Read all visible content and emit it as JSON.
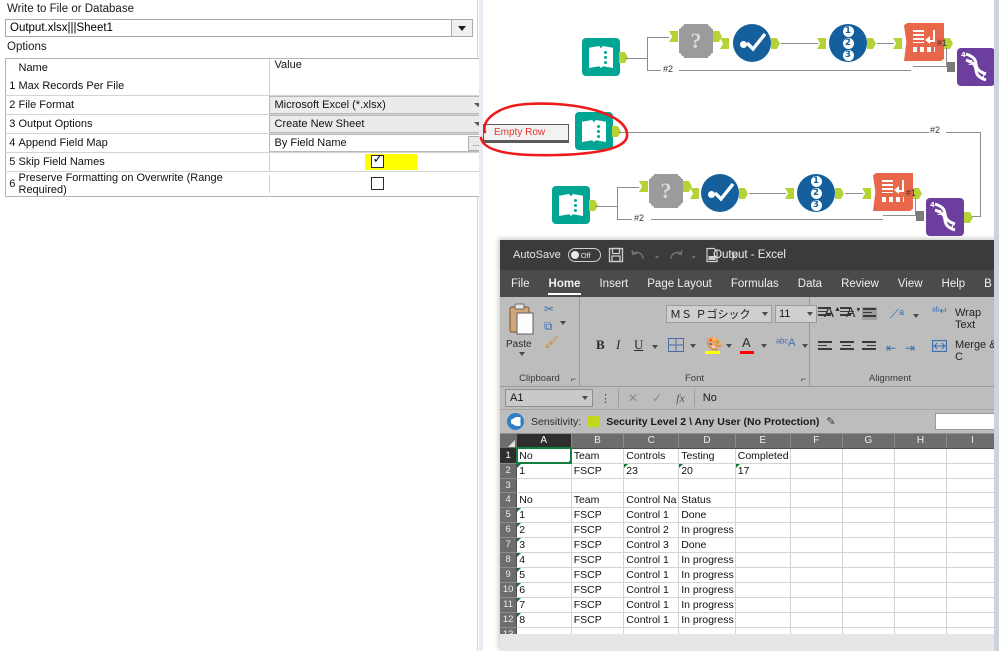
{
  "config_panel": {
    "title": "Write to File or Database",
    "file_value": "Output.xlsx|||Sheet1",
    "options_label": "Options",
    "columns": {
      "name": "Name",
      "value": "Value"
    },
    "rows": [
      {
        "num": "1",
        "name": "Max Records Per File",
        "value": "",
        "control": "blank"
      },
      {
        "num": "2",
        "name": "File Format",
        "value": "Microsoft Excel (*.xlsx)",
        "control": "combo"
      },
      {
        "num": "3",
        "name": "Output Options",
        "value": "Create New Sheet",
        "control": "combo"
      },
      {
        "num": "4",
        "name": "Append Field Map",
        "value": "By Field Name",
        "control": "text-ellipsis",
        "ellipsis": "..."
      },
      {
        "num": "5",
        "name": "Skip Field Names",
        "value": "",
        "control": "checkbox-checked-highlighted"
      },
      {
        "num": "6",
        "name": "Preserve Formatting on Overwrite (Range Required)",
        "value": "",
        "control": "checkbox-unchecked"
      }
    ]
  },
  "canvas": {
    "annotation": {
      "comment_label": "Empty Row",
      "highlight_color": "#ff0000"
    },
    "connection_labels": {
      "out2_top": "#2",
      "out2_bottom": "#2",
      "out1_top": "#1",
      "out1_bottom": "#1",
      "row_mid": "#2"
    },
    "tools": [
      {
        "id": "browse-top",
        "icon": "browse-icon",
        "color": "#00a693"
      },
      {
        "id": "dynamic-input-top",
        "icon": "gear-question-icon",
        "color": "#9b9b9b"
      },
      {
        "id": "filter-top",
        "icon": "filter-check-icon",
        "color": "#15609c"
      },
      {
        "id": "sort-top",
        "icon": "sort-123-icon",
        "color": "#15609c"
      },
      {
        "id": "output-data-top",
        "icon": "output-data-icon",
        "color": "#e8664a"
      },
      {
        "id": "macro-top",
        "icon": "batch-macro-icon",
        "color": "#6c3f9e"
      },
      {
        "id": "browse-mid",
        "icon": "browse-icon",
        "color": "#00a693"
      },
      {
        "id": "browse-bottom",
        "icon": "browse-icon",
        "color": "#00a693"
      },
      {
        "id": "dynamic-input-bottom",
        "icon": "gear-question-icon",
        "color": "#9b9b9b"
      },
      {
        "id": "filter-bottom",
        "icon": "filter-check-icon",
        "color": "#15609c"
      },
      {
        "id": "sort-bottom",
        "icon": "sort-123-icon",
        "color": "#15609c"
      },
      {
        "id": "output-data-bottom",
        "icon": "output-data-icon",
        "color": "#e8664a"
      },
      {
        "id": "macro-bottom",
        "icon": "batch-macro-icon",
        "color": "#6c3f9e"
      }
    ]
  },
  "excel": {
    "titlebar": {
      "autosave_label": "AutoSave",
      "autosave_state": "Off",
      "document_title": "Output  -  Excel",
      "quick_access": [
        "save-icon",
        "undo-icon",
        "redo-icon",
        "print-preview-icon",
        "customize-qat-icon"
      ]
    },
    "tabs": [
      {
        "label": "File",
        "active": false
      },
      {
        "label": "Home",
        "active": true
      },
      {
        "label": "Insert",
        "active": false
      },
      {
        "label": "Page Layout",
        "active": false
      },
      {
        "label": "Formulas",
        "active": false
      },
      {
        "label": "Data",
        "active": false
      },
      {
        "label": "Review",
        "active": false
      },
      {
        "label": "View",
        "active": false
      },
      {
        "label": "Help",
        "active": false
      },
      {
        "label": "B",
        "active": false
      }
    ],
    "ribbon": {
      "groups": [
        {
          "name": "Clipboard",
          "label": "Clipboard"
        },
        {
          "name": "Font",
          "label": "Font"
        },
        {
          "name": "Alignment",
          "label": "Alignment"
        }
      ],
      "clipboard": {
        "paste_label": "Paste"
      },
      "font": {
        "font_name": "ＭＳ Ｐゴシック",
        "font_size": "11",
        "bold": "B",
        "italic": "I",
        "underline": "U",
        "grow_font": "A",
        "shrink_font": "A",
        "fill_color": "#ffff00",
        "font_color": "#ff0000"
      },
      "alignment": {
        "wrap_text": "Wrap Text",
        "merge_center": "Merge & C"
      }
    },
    "formula_bar": {
      "name_box": "A1",
      "cancel_icon": "close-icon",
      "enter_icon": "check-icon",
      "function_icon": "fx-icon",
      "formula_value": "No"
    },
    "sensitivity_bar": {
      "icon": "sensitivity-label-icon",
      "label": "Sensitivity:",
      "swatch_color": "#c2d71a",
      "value": "Security Level 2 \\ Any User (No Protection)",
      "edit_icon": "pencil-icon"
    },
    "grid": {
      "column_headers": [
        "A",
        "B",
        "C",
        "D",
        "E",
        "F",
        "G",
        "H",
        "I"
      ],
      "selected_column": "A",
      "selected_row": "1",
      "active_cell": "A1",
      "row_numbers": [
        "1",
        "2",
        "3",
        "4",
        "5",
        "6",
        "7",
        "8",
        "9",
        "10",
        "11",
        "12",
        "13"
      ],
      "rows": [
        {
          "n": "1",
          "cells": [
            "No",
            "Team",
            "Controls",
            "Testing",
            "Completed",
            "",
            "",
            "",
            ""
          ],
          "errors": []
        },
        {
          "n": "2",
          "cells": [
            "1",
            "FSCP",
            "23",
            "20",
            "17",
            "",
            "",
            "",
            ""
          ],
          "errors": [
            0,
            2,
            3,
            4
          ]
        },
        {
          "n": "3",
          "cells": [
            "",
            "",
            "",
            "",
            "",
            "",
            "",
            "",
            ""
          ],
          "errors": []
        },
        {
          "n": "4",
          "cells": [
            "No",
            "Team",
            "Control Na",
            "Status",
            "",
            "",
            "",
            "",
            ""
          ],
          "errors": []
        },
        {
          "n": "5",
          "cells": [
            "1",
            "FSCP",
            "Control 1",
            "Done",
            "",
            "",
            "",
            "",
            ""
          ],
          "errors": [
            0
          ]
        },
        {
          "n": "6",
          "cells": [
            "2",
            "FSCP",
            "Control 2",
            "In progress",
            "",
            "",
            "",
            "",
            ""
          ],
          "errors": [
            0
          ]
        },
        {
          "n": "7",
          "cells": [
            "3",
            "FSCP",
            "Control 3",
            "Done",
            "",
            "",
            "",
            "",
            ""
          ],
          "errors": [
            0
          ]
        },
        {
          "n": "8",
          "cells": [
            "4",
            "FSCP",
            "Control 1",
            "In progress",
            "",
            "",
            "",
            "",
            ""
          ],
          "errors": [
            0
          ]
        },
        {
          "n": "9",
          "cells": [
            "5",
            "FSCP",
            "Control 1",
            "In progress",
            "",
            "",
            "",
            "",
            ""
          ],
          "errors": [
            0
          ]
        },
        {
          "n": "10",
          "cells": [
            "6",
            "FSCP",
            "Control 1",
            "In progress",
            "",
            "",
            "",
            "",
            ""
          ],
          "errors": [
            0
          ]
        },
        {
          "n": "11",
          "cells": [
            "7",
            "FSCP",
            "Control 1",
            "In progress",
            "",
            "",
            "",
            "",
            ""
          ],
          "errors": [
            0
          ]
        },
        {
          "n": "12",
          "cells": [
            "8",
            "FSCP",
            "Control 1",
            "In progress",
            "",
            "",
            "",
            "",
            ""
          ],
          "errors": [
            0
          ]
        },
        {
          "n": "13",
          "cells": [
            "",
            "",
            "",
            "",
            "",
            "",
            "",
            "",
            ""
          ],
          "errors": []
        }
      ]
    }
  }
}
